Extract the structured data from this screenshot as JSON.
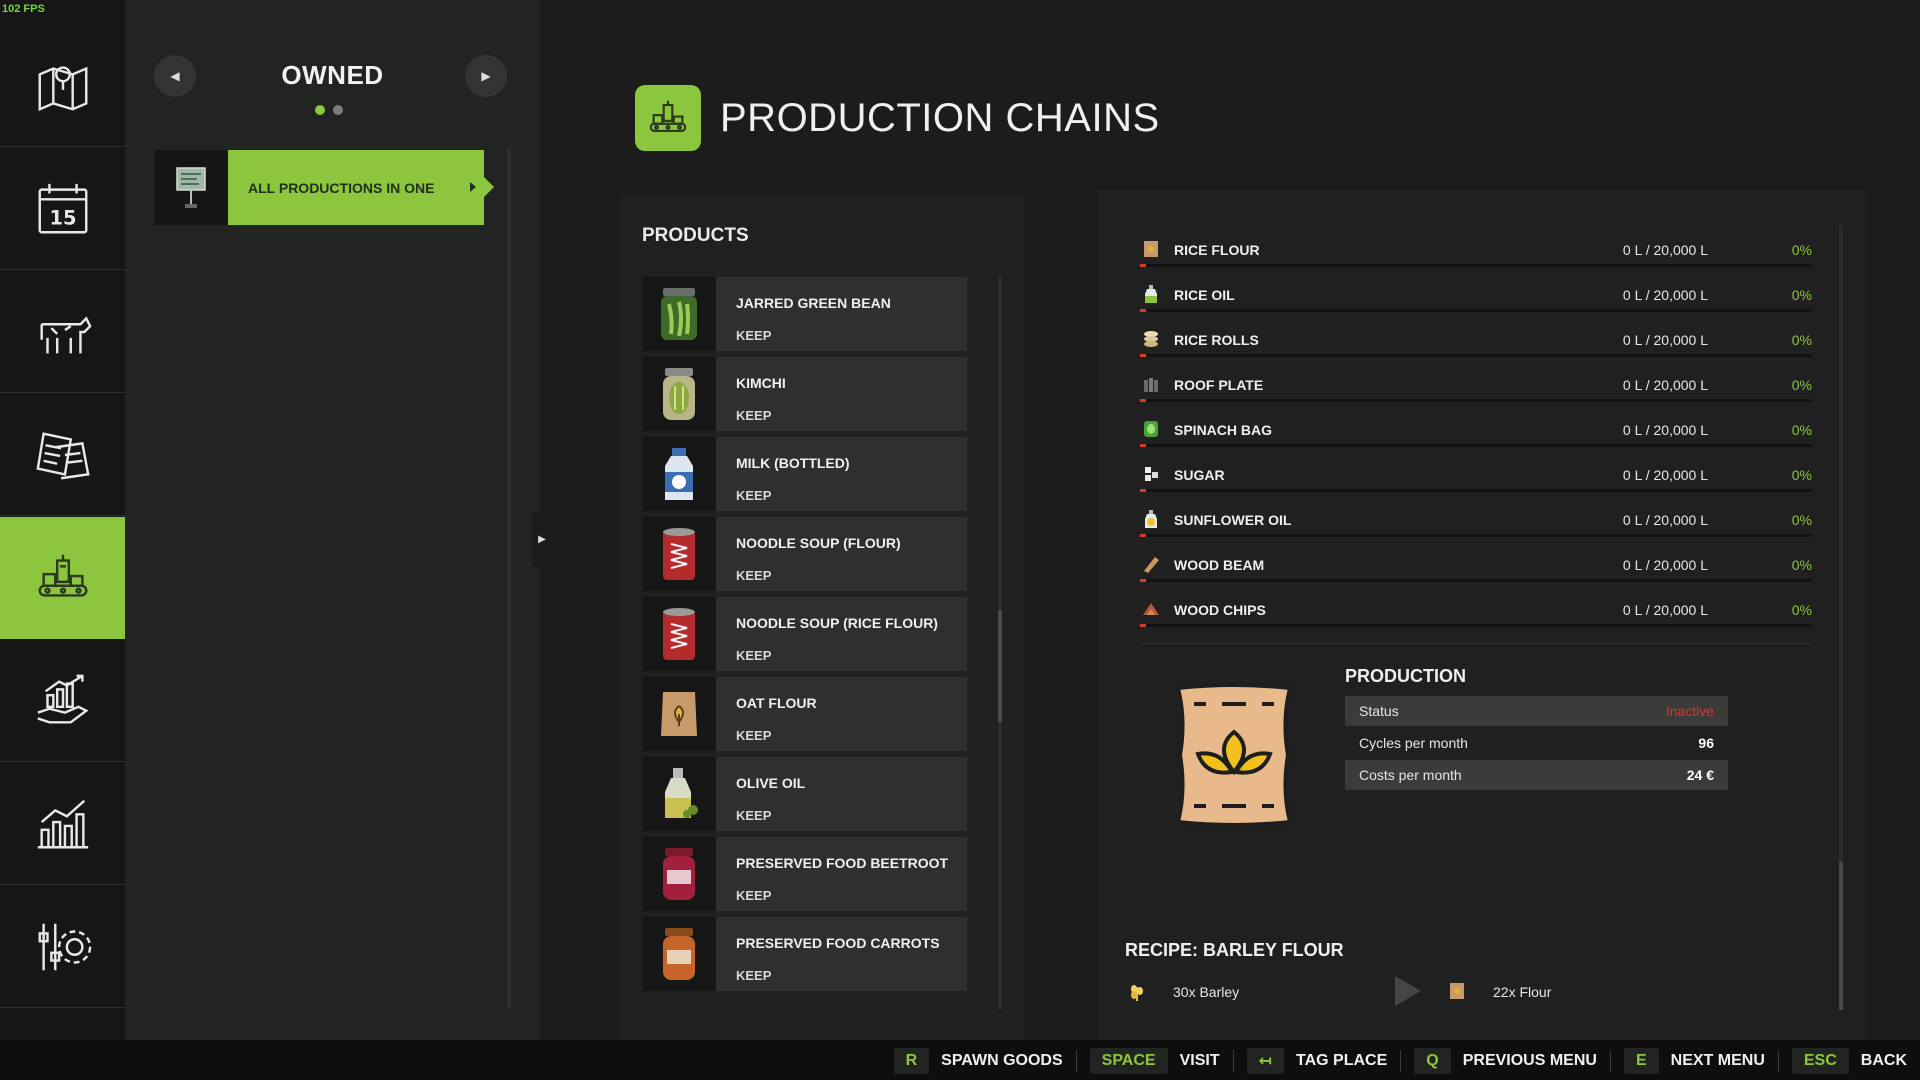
{
  "fps": "102 FPS",
  "colors": {
    "accent": "#8cc63f",
    "inactive": "#e0322a",
    "bar_fill": "#d23a2a"
  },
  "nav": {
    "items": [
      {
        "icon": "map-icon"
      },
      {
        "icon": "calendar-icon",
        "text": "15"
      },
      {
        "icon": "cow-icon"
      },
      {
        "icon": "contracts-icon"
      },
      {
        "icon": "production-icon",
        "active": true
      },
      {
        "icon": "finance-icon"
      },
      {
        "icon": "statistics-icon"
      },
      {
        "icon": "settings-icon"
      }
    ]
  },
  "owned": {
    "title": "OWNED",
    "page_dots": 2,
    "active_dot": 0,
    "entries": [
      {
        "label": "ALL PRODUCTIONS IN ONE",
        "icon": "sign-icon",
        "selected": true
      }
    ]
  },
  "header": {
    "title": "PRODUCTION CHAINS",
    "icon": "production-icon"
  },
  "products": {
    "title": "PRODUCTS",
    "items": [
      {
        "name": "JARRED GREEN BEAN",
        "mode": "KEEP",
        "icon": "jar-icon"
      },
      {
        "name": "KIMCHI",
        "mode": "KEEP",
        "icon": "kimchi-jar-icon"
      },
      {
        "name": "MILK (BOTTLED)",
        "mode": "KEEP",
        "icon": "milk-bottle-icon"
      },
      {
        "name": "NOODLE SOUP (FLOUR)",
        "mode": "KEEP",
        "icon": "soup-can-icon"
      },
      {
        "name": "NOODLE SOUP (RICE FLOUR)",
        "mode": "KEEP",
        "icon": "soup-can-icon"
      },
      {
        "name": "OAT FLOUR",
        "mode": "KEEP",
        "icon": "flour-sack-icon"
      },
      {
        "name": "OLIVE OIL",
        "mode": "KEEP",
        "icon": "olive-oil-icon"
      },
      {
        "name": "PRESERVED FOOD BEETROOT",
        "mode": "KEEP",
        "icon": "beetroot-jar-icon"
      },
      {
        "name": "PRESERVED FOOD CARROTS",
        "mode": "KEEP",
        "icon": "carrot-jar-icon"
      }
    ]
  },
  "storage": [
    {
      "name": "RICE FLOUR",
      "amount": "0 L / 20,000 L",
      "percent": "0%",
      "icon": "flour-bag-icon"
    },
    {
      "name": "RICE OIL",
      "amount": "0 L / 20,000 L",
      "percent": "0%",
      "icon": "oil-bottle-icon"
    },
    {
      "name": "RICE ROLLS",
      "amount": "0 L / 20,000 L",
      "percent": "0%",
      "icon": "rice-rolls-icon"
    },
    {
      "name": "ROOF PLATE",
      "amount": "0 L / 20,000 L",
      "percent": "0%",
      "icon": "roof-plate-icon"
    },
    {
      "name": "SPINACH BAG",
      "amount": "0 L / 20,000 L",
      "percent": "0%",
      "icon": "spinach-bag-icon"
    },
    {
      "name": "SUGAR",
      "amount": "0 L / 20,000 L",
      "percent": "0%",
      "icon": "sugar-icon"
    },
    {
      "name": "SUNFLOWER OIL",
      "amount": "0 L / 20,000 L",
      "percent": "0%",
      "icon": "sunflower-oil-icon"
    },
    {
      "name": "WOOD BEAM",
      "amount": "0 L / 20,000 L",
      "percent": "0%",
      "icon": "wood-beam-icon"
    },
    {
      "name": "WOOD CHIPS",
      "amount": "0 L / 20,000 L",
      "percent": "0%",
      "icon": "wood-chips-icon"
    }
  ],
  "production": {
    "title": "PRODUCTION",
    "icon": "flour-sack-icon",
    "status_label": "Status",
    "status_value": "Inactive",
    "cycles_label": "Cycles per month",
    "cycles_value": "96",
    "costs_label": "Costs per month",
    "costs_value": "24 €"
  },
  "recipe": {
    "title": "RECIPE: BARLEY FLOUR",
    "input": "30x Barley",
    "input_icon": "barley-icon",
    "output": "22x Flour",
    "output_icon": "flour-bag-icon"
  },
  "hints": [
    {
      "key": "R",
      "label": "SPAWN GOODS"
    },
    {
      "key": "SPACE",
      "label": "VISIT"
    },
    {
      "key": "↤",
      "label": "TAG PLACE"
    },
    {
      "key": "Q",
      "label": "PREVIOUS MENU"
    },
    {
      "key": "E",
      "label": "NEXT MENU"
    },
    {
      "key": "ESC",
      "label": "BACK"
    }
  ]
}
